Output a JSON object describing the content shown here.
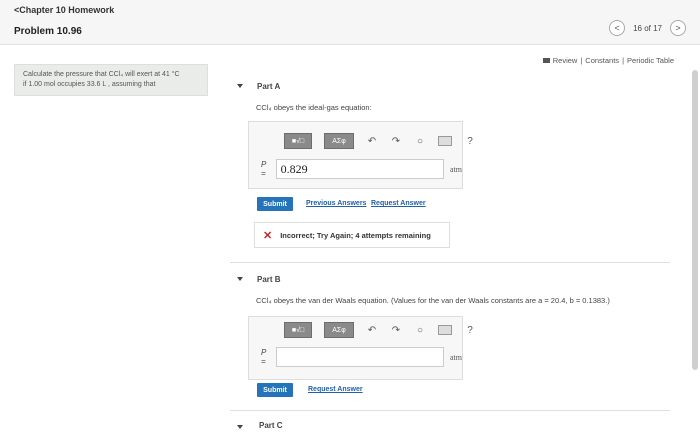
{
  "header": {
    "back_label": "<Chapter 10 Homework",
    "problem_title": "Problem 10.96",
    "page_indicator": "16 of 17",
    "prev": "<",
    "next": ">"
  },
  "resources": {
    "review": "Review",
    "sep1": "|",
    "constants": "Constants",
    "sep2": "|",
    "periodic": "Periodic Table"
  },
  "sidebar": {
    "line1": "Calculate the pressure that CCl₄ will exert at 41 °C",
    "line2": "if 1.00 mol occupies 33.6 L , assuming that"
  },
  "toolbar": {
    "fraction_btn": "■√□",
    "greek_btn": "AΣφ",
    "undo_icon": "↶",
    "redo_icon": "↷",
    "reset_icon": "○",
    "help_icon": "?"
  },
  "partA": {
    "title": "Part A",
    "prompt": "CCl₄ obeys the ideal-gas equation:",
    "var_label": "P =",
    "value": "0.829",
    "unit": "atm",
    "submit": "Submit",
    "prev_answers": "Previous Answers",
    "request_answer": "Request Answer",
    "feedback": "Incorrect; Try Again; 4 attempts remaining",
    "feedback_icon": "✕"
  },
  "partB": {
    "title": "Part B",
    "prompt": "CCl₄ obeys the van der Waals equation. (Values for the van der Waals constants are a = 20.4, b = 0.1383.)",
    "var_label": "P =",
    "value": "",
    "unit": "atm",
    "submit": "Submit",
    "request_answer": "Request Answer"
  },
  "partC": {
    "title": "Part C"
  },
  "colors": {
    "submit_blue": "#2573b8",
    "error_red": "#c62828",
    "panel_bg": "#e9ece8"
  }
}
